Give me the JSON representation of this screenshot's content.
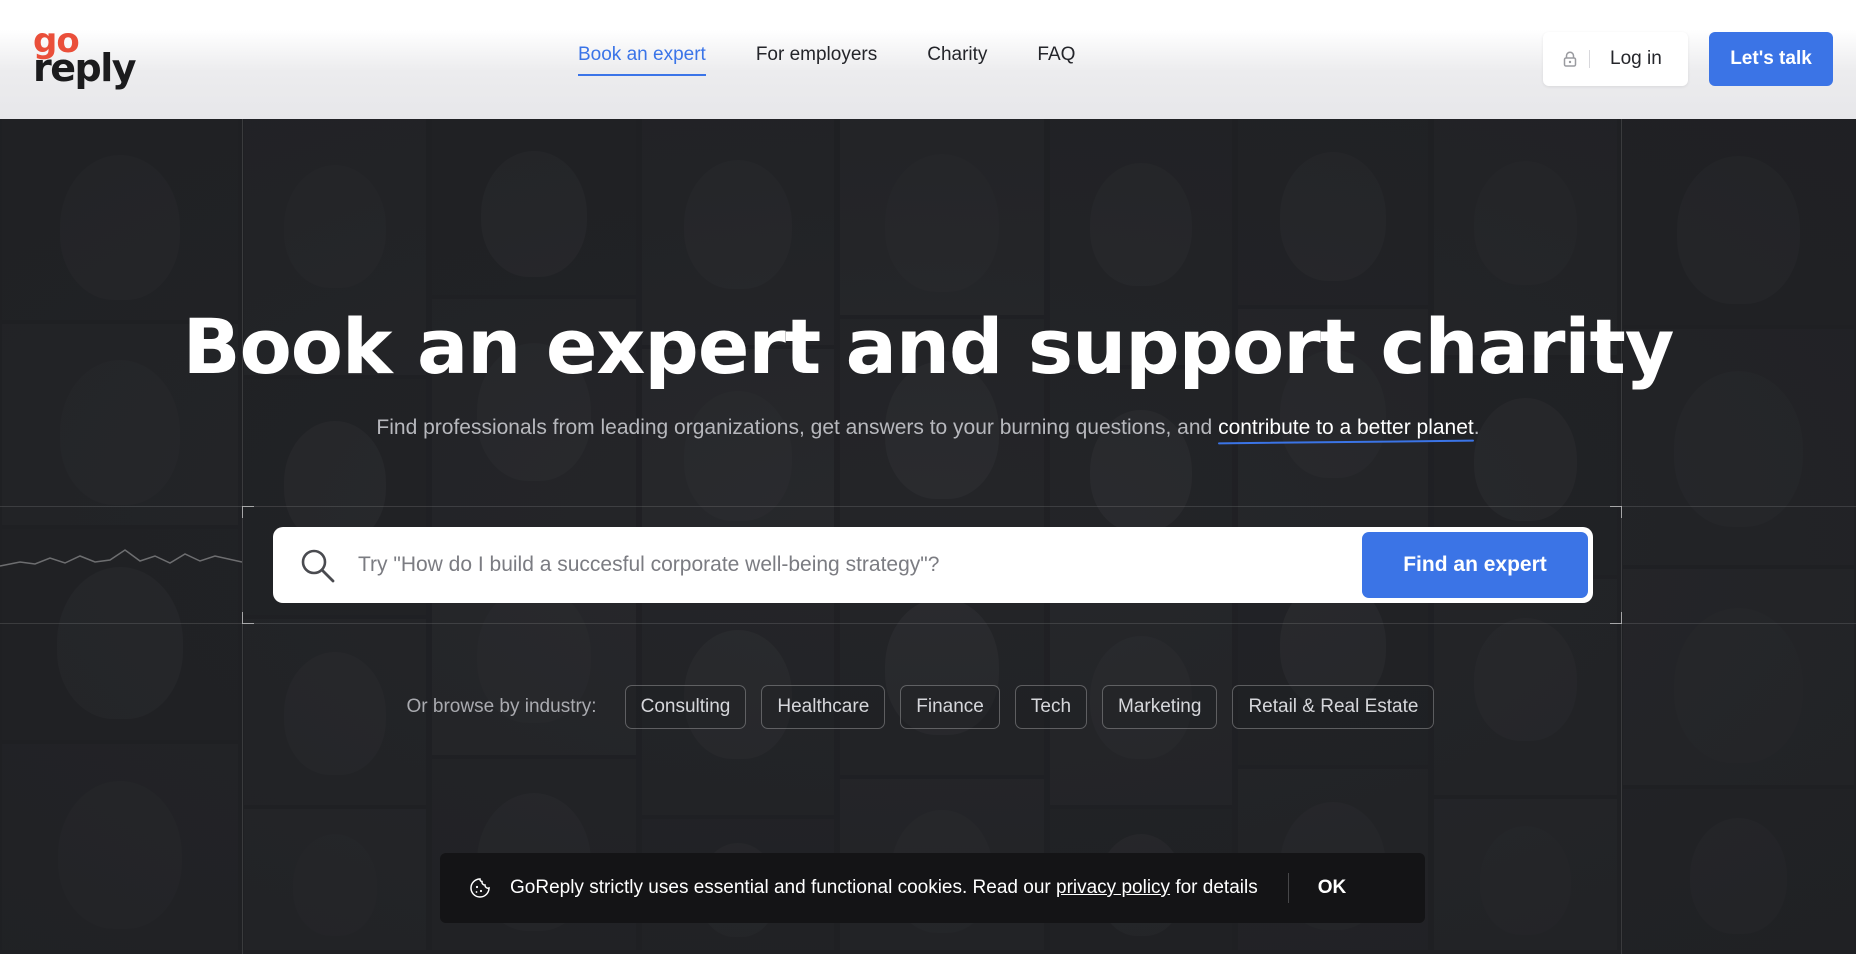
{
  "header": {
    "logo": {
      "top": "go",
      "bottom": "reply"
    },
    "nav": [
      {
        "label": "Book an expert",
        "active": true
      },
      {
        "label": "For employers",
        "active": false
      },
      {
        "label": "Charity",
        "active": false
      },
      {
        "label": "FAQ",
        "active": false
      }
    ],
    "login_label": "Log in",
    "cta_label": "Let's talk"
  },
  "hero": {
    "title": "Book an expert and support charity",
    "subtitle_pre": "Find professionals from leading organizations, get answers to your burning questions, and ",
    "subtitle_highlight": "contribute to a better planet",
    "subtitle_post": ".",
    "search": {
      "placeholder": "Try \"How do I build a succesful corporate well-being strategy\"?",
      "button_label": "Find an expert"
    },
    "browse": {
      "label": "Or browse by industry:",
      "industries": [
        "Consulting",
        "Healthcare",
        "Finance",
        "Tech",
        "Marketing",
        "Retail & Real Estate"
      ]
    }
  },
  "cookie": {
    "text_pre": "GoReply strictly uses essential and functional cookies. Read our ",
    "link": "privacy policy",
    "text_post": " for details",
    "ok_label": "OK"
  },
  "colors": {
    "accent": "#3b74e6",
    "logo_red": "#ea4f3a",
    "dark_bg": "#1e1f22"
  },
  "icons": [
    "lock-icon",
    "search-icon",
    "cookie-icon"
  ]
}
